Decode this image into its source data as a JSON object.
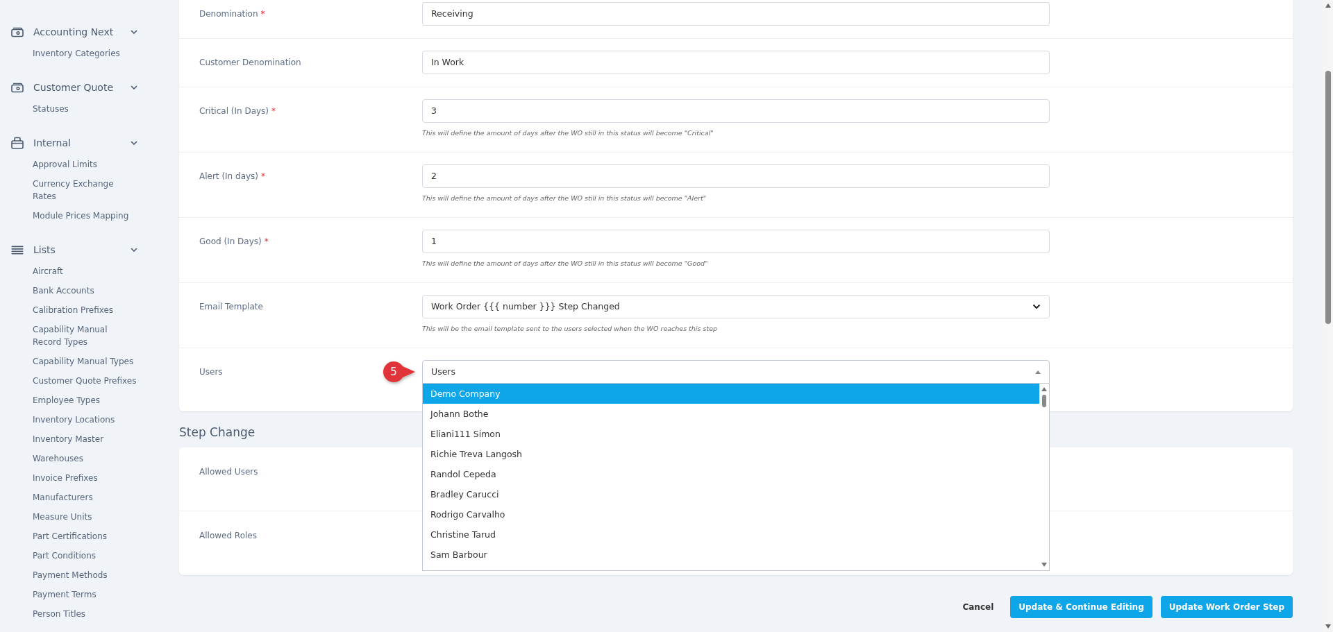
{
  "sidebar": {
    "sections": [
      {
        "title": "Accounting Next",
        "kind": "wallet",
        "expanded": true,
        "items": [
          {
            "label": "Inventory Categories"
          }
        ]
      },
      {
        "title": "Customer Quote",
        "kind": "wallet",
        "expanded": true,
        "items": [
          {
            "label": "Statuses"
          }
        ]
      },
      {
        "title": "Internal",
        "kind": "case",
        "expanded": true,
        "items": [
          {
            "label": "Approval Limits"
          },
          {
            "label": "Currency Exchange Rates"
          },
          {
            "label": "Module Prices Mapping"
          }
        ]
      },
      {
        "title": "Lists",
        "kind": "list",
        "expanded": true,
        "items": [
          {
            "label": "Aircraft"
          },
          {
            "label": "Bank Accounts"
          },
          {
            "label": "Calibration Prefixes"
          },
          {
            "label": "Capability Manual Record Types"
          },
          {
            "label": "Capability Manual Types"
          },
          {
            "label": "Customer Quote Prefixes"
          },
          {
            "label": "Employee Types"
          },
          {
            "label": "Inventory Locations"
          },
          {
            "label": "Inventory Master"
          },
          {
            "label": "Warehouses"
          },
          {
            "label": "Invoice Prefixes"
          },
          {
            "label": "Manufacturers"
          },
          {
            "label": "Measure Units"
          },
          {
            "label": "Part Certifications"
          },
          {
            "label": "Part Conditions"
          },
          {
            "label": "Payment Methods"
          },
          {
            "label": "Payment Terms"
          },
          {
            "label": "Person Titles"
          }
        ]
      }
    ]
  },
  "form": {
    "rows": [
      {
        "label": "Denomination",
        "required_mark": "*",
        "kind": "input",
        "value": "Receiving"
      },
      {
        "label": "Customer Denomination",
        "kind": "input",
        "value": "In Work"
      },
      {
        "label": "Critical (In Days)",
        "required_mark": "*",
        "kind": "input",
        "value": "3",
        "hint": "This will define the amount of days after the WO still in this status will become \"Critical\""
      },
      {
        "label": "Alert (In days)",
        "required_mark": "*",
        "kind": "input",
        "value": "2",
        "hint": "This will define the amount of days after the WO still in this status will become \"Alert\""
      },
      {
        "label": "Good (In Days)",
        "required_mark": "*",
        "kind": "input",
        "value": "1",
        "hint": "This will define the amount of days after the WO still in this status will become \"Good\""
      },
      {
        "label": "Email Template",
        "kind": "select",
        "value": "Work Order {{{ number }}} Step Changed",
        "hint": "This will be the email template sent to the users selected when the WO reaches this step"
      },
      {
        "label": "Users",
        "kind": "multiselect",
        "placeholder": "Users",
        "open": true,
        "badge": "5",
        "options": [
          {
            "label": "Demo Company",
            "selected": true
          },
          {
            "label": "Johann Bothe",
            "selected": false
          },
          {
            "label": "Eliani111 Simon",
            "selected": false
          },
          {
            "label": "Richie Treva Langosh",
            "selected": false
          },
          {
            "label": "Randol Cepeda",
            "selected": false
          },
          {
            "label": "Bradley Carucci",
            "selected": false
          },
          {
            "label": "Rodrigo Carvalho",
            "selected": false
          },
          {
            "label": "Christine Tarud",
            "selected": false
          },
          {
            "label": "Sam Barbour",
            "selected": false
          }
        ]
      }
    ]
  },
  "step_change": {
    "title": "Step Change",
    "rows": [
      {
        "label": "Allowed Users"
      },
      {
        "label": "Allowed Roles"
      }
    ]
  },
  "actions": [
    {
      "label": "Cancel",
      "kind": "link"
    },
    {
      "label": "Update & Continue Editing",
      "kind": "primary"
    },
    {
      "label": "Update Work Order Step",
      "kind": "primary"
    }
  ]
}
